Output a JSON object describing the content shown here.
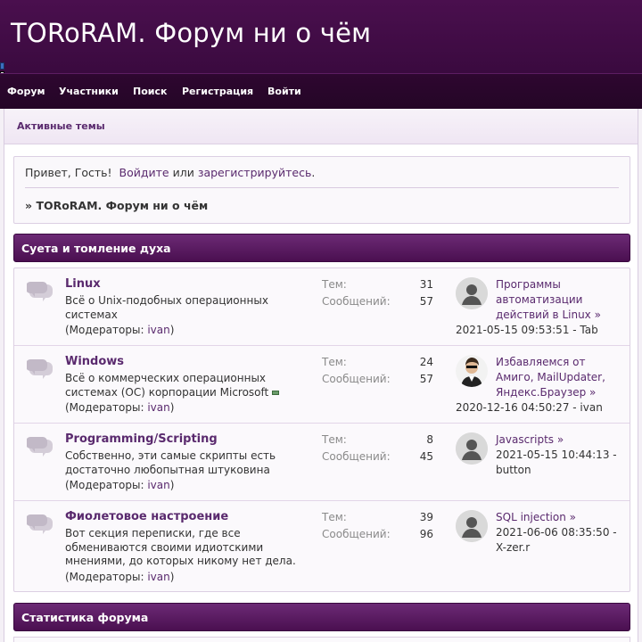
{
  "site": {
    "title": "TORoRAM. Форум ни о чём"
  },
  "nav": {
    "items": [
      {
        "label": "Форум"
      },
      {
        "label": "Участники"
      },
      {
        "label": "Поиск"
      },
      {
        "label": "Регистрация"
      },
      {
        "label": "Войти"
      }
    ]
  },
  "subnav": {
    "active_topics": "Активные темы"
  },
  "welcome": {
    "greeting": "Привет, Гость!",
    "login_link": "Войдите",
    "or": "или",
    "register_link": "зарегистрируйтесь",
    "dot": ".",
    "crumb_prefix": "»",
    "crumb": "TORoRAM. Форум ни о чём"
  },
  "category": {
    "title": "Суета и томление духа",
    "topics_label": "Тем:",
    "posts_label": "Сообщений:",
    "mods_prefix": "(Модераторы:",
    "mods_suffix": ")",
    "forums": [
      {
        "name": "Linux",
        "desc": "Всё о Unix-подобных операционных системах",
        "mod": "ivan",
        "topics": "31",
        "posts": "57",
        "last_title": "Программы автоматизации действий в Linux",
        "last_meta": "2021-05-15 09:53:51 - Tab"
      },
      {
        "name": "Windows",
        "desc": "Всё о коммерческих операционных системах (ОС) корпорации Microsoft",
        "mod": "ivan",
        "topics": "24",
        "posts": "57",
        "last_title": "Избавляемся от Амиго, MailUpdater, Яндекс.Браузер",
        "last_meta": "2020-12-16 04:50:27 - ivan"
      },
      {
        "name": "Programming/Scripting",
        "desc": "Собственно, эти самые скрипты есть достаточно любопытная штуковина",
        "mod": "ivan",
        "topics": "8",
        "posts": "45",
        "last_title": "Javascripts",
        "last_meta": "2021-05-15 10:44:13 - button"
      },
      {
        "name": "Фиолетовое настроение",
        "desc": "Вот секция переписки, где все обмениваются своими идиотскими мнениями, до которых никому нет дела.",
        "mod": "ivan",
        "topics": "39",
        "posts": "96",
        "last_title": "SQL injection",
        "last_meta": "2021-06-06 08:35:50 - X-zer.r"
      }
    ]
  },
  "stats": {
    "title": "Статистика форума"
  },
  "arrow": "»",
  "colors": {
    "header": "#3a0a3f",
    "accent": "#5a2a6e",
    "category_bar": "#5a1a62"
  }
}
